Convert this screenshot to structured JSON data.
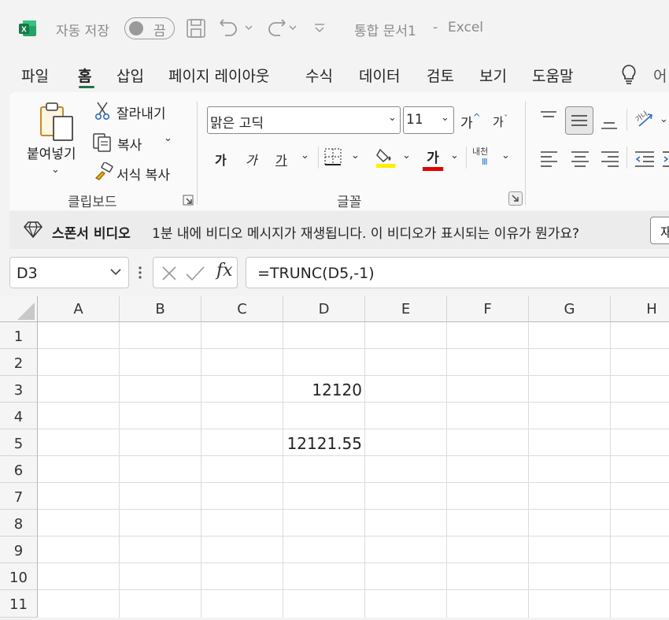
{
  "titlebar": {
    "autosave_label": "자동 저장",
    "toggle_state": "끔",
    "doc_title": "통합 문서1",
    "separator": "-",
    "app_name": "Excel"
  },
  "menu": {
    "tabs": [
      "파일",
      "홈",
      "삽입",
      "페이지 레이아웃",
      "수식",
      "데이터",
      "검토",
      "보기",
      "도움말"
    ],
    "active_tab": "홈",
    "overflow": "어"
  },
  "ribbon": {
    "clipboard": {
      "paste_label": "붙여넣기",
      "cut_label": "잘라내기",
      "copy_label": "복사",
      "format_painter_label": "서식 복사",
      "group_label": "클립보드"
    },
    "font": {
      "font_name": "맑은 고딕",
      "font_size": "11",
      "grow_label": "가",
      "shrink_label": "가",
      "bold_label": "가",
      "italic_label": "가",
      "underline_label": "가",
      "font_color_label": "가",
      "phonetic_label": "내천",
      "group_label": "글꼴"
    },
    "colors": {
      "accent": "#217346",
      "highlight": "#ffee00",
      "font_color": "#e60000"
    }
  },
  "sponsor": {
    "title": "스폰서 비디오",
    "message": "1분 내에 비디오 메시지가 재생됩니다. 이 비디오가 표시되는 이유가 뭔가요?",
    "button_label": "재"
  },
  "formula_bar": {
    "name_box": "D3",
    "fx_label": "fx",
    "formula": "=TRUNC(D5,-1)"
  },
  "sheet": {
    "columns": [
      "A",
      "B",
      "C",
      "D",
      "E",
      "F",
      "G",
      "H"
    ],
    "rows": [
      "1",
      "2",
      "3",
      "4",
      "5",
      "6",
      "7",
      "8",
      "9",
      "10",
      "11"
    ],
    "cells": {
      "D3": "12120",
      "D5": "12121.55"
    },
    "selected_cell": "D3"
  }
}
